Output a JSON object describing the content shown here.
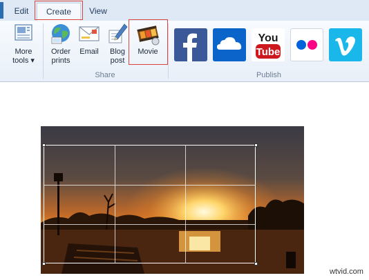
{
  "tabs": [
    {
      "label": "Edit"
    },
    {
      "label": "Create"
    },
    {
      "label": "View"
    }
  ],
  "share_group": {
    "label": "Share",
    "buttons": [
      {
        "line1": "More",
        "line2": "tools ▾",
        "icon": "more-tools-icon"
      },
      {
        "line1": "Order",
        "line2": "prints",
        "icon": "globe-icon"
      },
      {
        "line1": "Email",
        "line2": "",
        "icon": "email-icon"
      },
      {
        "line1": "Blog",
        "line2": "post",
        "icon": "pen-icon"
      },
      {
        "line1": "Movie",
        "line2": "",
        "icon": "film-icon"
      }
    ]
  },
  "publish_group": {
    "label": "Publish",
    "services": [
      {
        "name": "Facebook",
        "icon": "facebook-icon",
        "color": "#3b5998"
      },
      {
        "name": "OneDrive",
        "icon": "onedrive-icon",
        "color": "#0a64c9"
      },
      {
        "name": "YouTube",
        "icon": "youtube-icon",
        "color": "#cc181e",
        "text_top": "You",
        "text_bottom": "Tube"
      },
      {
        "name": "Flickr",
        "icon": "flickr-icon",
        "color": "#0063dc"
      },
      {
        "name": "Vimeo",
        "icon": "vimeo-icon",
        "color": "#19b7ea"
      }
    ]
  },
  "watermark": "wtvid.com"
}
